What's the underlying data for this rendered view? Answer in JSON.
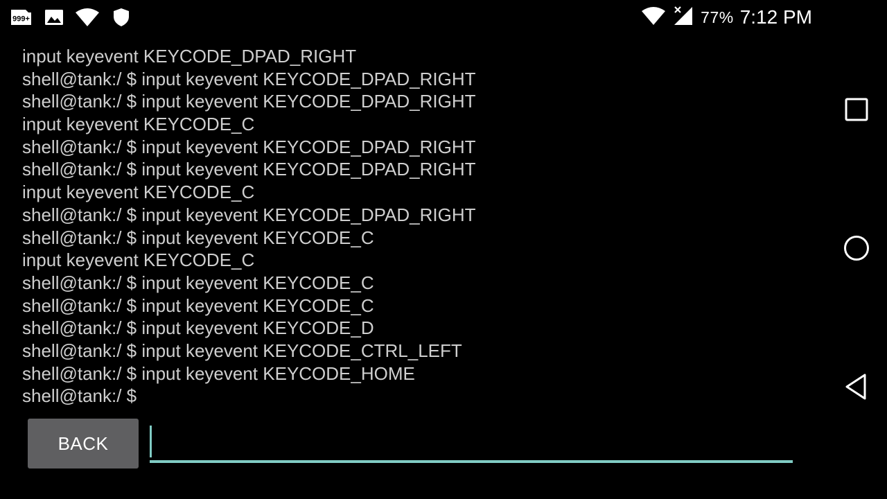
{
  "status_bar": {
    "notification_count_badge": "999+",
    "icons_left": [
      "notification-count-icon",
      "image-icon",
      "wifi-icon",
      "shield-icon"
    ],
    "icons_right": [
      "wifi-icon",
      "cellular-no-signal-icon"
    ],
    "battery_percent": "77%",
    "time": "7:12 PM"
  },
  "terminal": {
    "lines": [
      "input keyevent KEYCODE_DPAD_RIGHT",
      "shell@tank:/ $ input keyevent KEYCODE_DPAD_RIGHT",
      "shell@tank:/ $ input keyevent KEYCODE_DPAD_RIGHT",
      "input keyevent KEYCODE_C",
      "shell@tank:/ $ input keyevent KEYCODE_DPAD_RIGHT",
      "shell@tank:/ $ input keyevent KEYCODE_DPAD_RIGHT",
      "input keyevent KEYCODE_C",
      "shell@tank:/ $ input keyevent KEYCODE_DPAD_RIGHT",
      "shell@tank:/ $ input keyevent KEYCODE_C",
      "input keyevent KEYCODE_C",
      "shell@tank:/ $ input keyevent KEYCODE_C",
      "shell@tank:/ $ input keyevent KEYCODE_C",
      "shell@tank:/ $ input keyevent KEYCODE_D",
      "shell@tank:/ $ input keyevent KEYCODE_CTRL_LEFT",
      "shell@tank:/ $ input keyevent KEYCODE_HOME",
      "shell@tank:/ $"
    ]
  },
  "input_row": {
    "back_label": "BACK",
    "command_value": "",
    "accent_color": "#80cbc4"
  },
  "nav_bar": {
    "buttons": [
      "recents-icon",
      "home-icon",
      "back-icon"
    ]
  },
  "colors": {
    "background": "#000000",
    "terminal_text": "#cfcfcf",
    "button_bg": "#5f5f61",
    "accent": "#80cbc4"
  }
}
